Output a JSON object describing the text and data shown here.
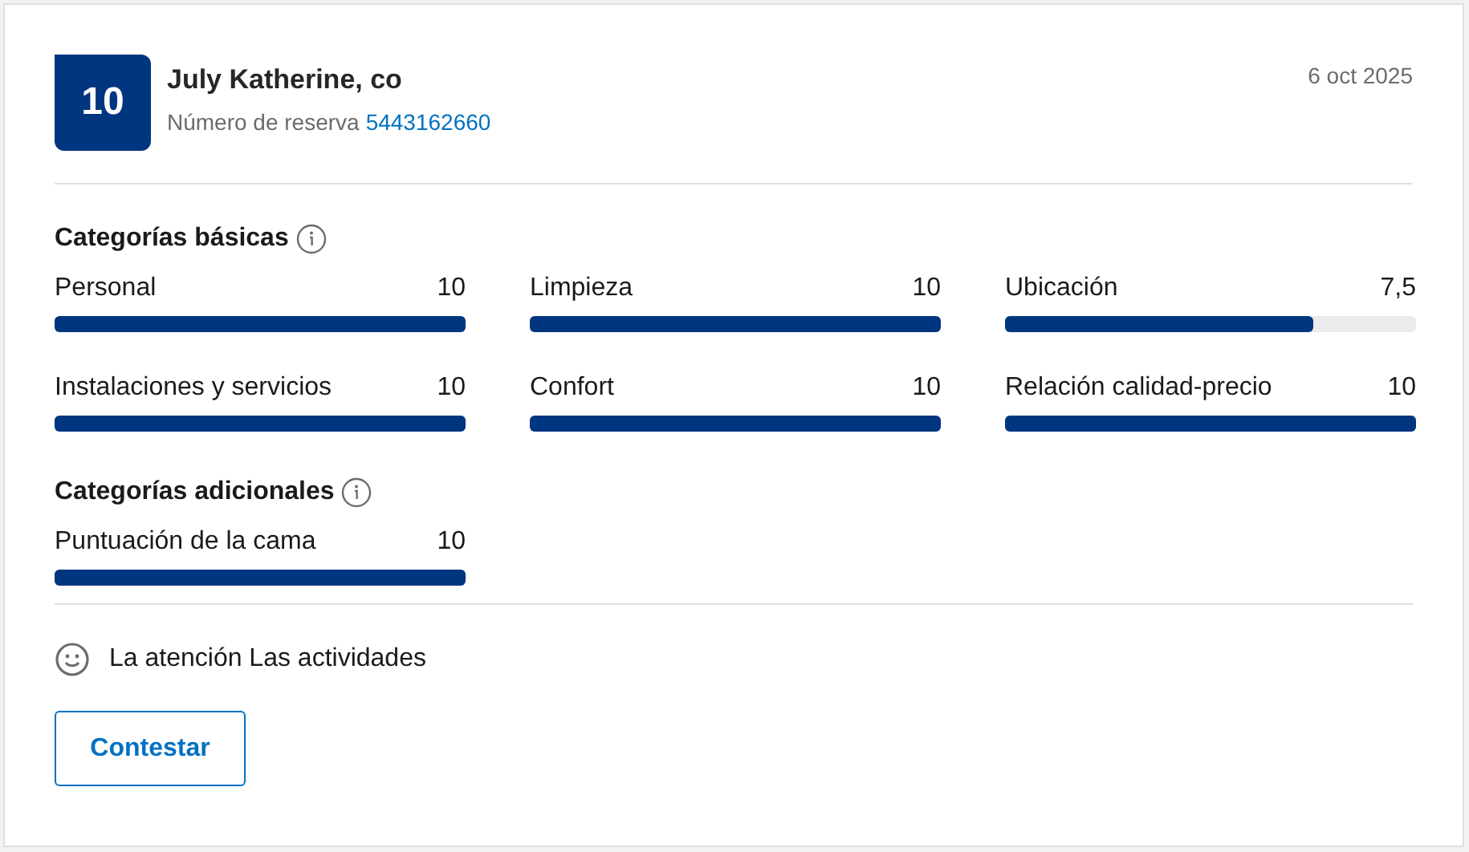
{
  "review": {
    "score": "10",
    "guest": "July Katherine, co",
    "booking_label": "Número de reserva",
    "booking_number": "5443162660",
    "date": "6 oct 2025"
  },
  "sections": [
    {
      "title": "Categorías básicas",
      "categories": [
        {
          "name": "Personal",
          "score": "10",
          "level": 1
        },
        {
          "name": "Limpieza",
          "score": "10",
          "level": 1
        },
        {
          "name": "Ubicación",
          "score": "7,5",
          "level": 0.75
        },
        {
          "name": "Instalaciones y servicios",
          "score": "10",
          "level": 1
        },
        {
          "name": "Confort",
          "score": "10",
          "level": 1
        },
        {
          "name": "Relación calidad-precio",
          "score": "10",
          "level": 1
        }
      ]
    },
    {
      "title": "Categorías adicionales",
      "categories": [
        {
          "name": "Puntuación de la cama",
          "score": "10",
          "level": 1
        }
      ]
    }
  ],
  "comment": "La atención Las actividades",
  "reply_button": "Contestar"
}
